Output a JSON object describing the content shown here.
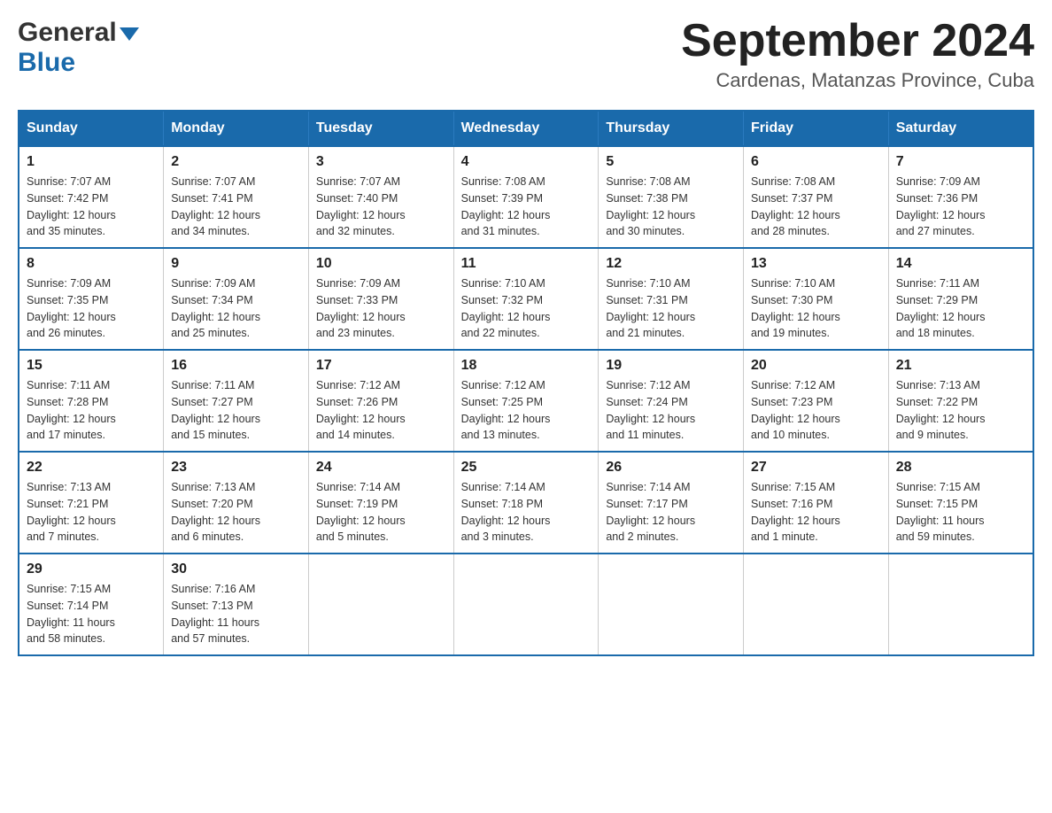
{
  "header": {
    "logo_general": "General",
    "logo_blue": "Blue",
    "month_title": "September 2024",
    "location": "Cardenas, Matanzas Province, Cuba"
  },
  "calendar": {
    "days_of_week": [
      "Sunday",
      "Monday",
      "Tuesday",
      "Wednesday",
      "Thursday",
      "Friday",
      "Saturday"
    ],
    "weeks": [
      [
        {
          "day": "1",
          "sunrise": "7:07 AM",
          "sunset": "7:42 PM",
          "daylight": "12 hours and 35 minutes."
        },
        {
          "day": "2",
          "sunrise": "7:07 AM",
          "sunset": "7:41 PM",
          "daylight": "12 hours and 34 minutes."
        },
        {
          "day": "3",
          "sunrise": "7:07 AM",
          "sunset": "7:40 PM",
          "daylight": "12 hours and 32 minutes."
        },
        {
          "day": "4",
          "sunrise": "7:08 AM",
          "sunset": "7:39 PM",
          "daylight": "12 hours and 31 minutes."
        },
        {
          "day": "5",
          "sunrise": "7:08 AM",
          "sunset": "7:38 PM",
          "daylight": "12 hours and 30 minutes."
        },
        {
          "day": "6",
          "sunrise": "7:08 AM",
          "sunset": "7:37 PM",
          "daylight": "12 hours and 28 minutes."
        },
        {
          "day": "7",
          "sunrise": "7:09 AM",
          "sunset": "7:36 PM",
          "daylight": "12 hours and 27 minutes."
        }
      ],
      [
        {
          "day": "8",
          "sunrise": "7:09 AM",
          "sunset": "7:35 PM",
          "daylight": "12 hours and 26 minutes."
        },
        {
          "day": "9",
          "sunrise": "7:09 AM",
          "sunset": "7:34 PM",
          "daylight": "12 hours and 25 minutes."
        },
        {
          "day": "10",
          "sunrise": "7:09 AM",
          "sunset": "7:33 PM",
          "daylight": "12 hours and 23 minutes."
        },
        {
          "day": "11",
          "sunrise": "7:10 AM",
          "sunset": "7:32 PM",
          "daylight": "12 hours and 22 minutes."
        },
        {
          "day": "12",
          "sunrise": "7:10 AM",
          "sunset": "7:31 PM",
          "daylight": "12 hours and 21 minutes."
        },
        {
          "day": "13",
          "sunrise": "7:10 AM",
          "sunset": "7:30 PM",
          "daylight": "12 hours and 19 minutes."
        },
        {
          "day": "14",
          "sunrise": "7:11 AM",
          "sunset": "7:29 PM",
          "daylight": "12 hours and 18 minutes."
        }
      ],
      [
        {
          "day": "15",
          "sunrise": "7:11 AM",
          "sunset": "7:28 PM",
          "daylight": "12 hours and 17 minutes."
        },
        {
          "day": "16",
          "sunrise": "7:11 AM",
          "sunset": "7:27 PM",
          "daylight": "12 hours and 15 minutes."
        },
        {
          "day": "17",
          "sunrise": "7:12 AM",
          "sunset": "7:26 PM",
          "daylight": "12 hours and 14 minutes."
        },
        {
          "day": "18",
          "sunrise": "7:12 AM",
          "sunset": "7:25 PM",
          "daylight": "12 hours and 13 minutes."
        },
        {
          "day": "19",
          "sunrise": "7:12 AM",
          "sunset": "7:24 PM",
          "daylight": "12 hours and 11 minutes."
        },
        {
          "day": "20",
          "sunrise": "7:12 AM",
          "sunset": "7:23 PM",
          "daylight": "12 hours and 10 minutes."
        },
        {
          "day": "21",
          "sunrise": "7:13 AM",
          "sunset": "7:22 PM",
          "daylight": "12 hours and 9 minutes."
        }
      ],
      [
        {
          "day": "22",
          "sunrise": "7:13 AM",
          "sunset": "7:21 PM",
          "daylight": "12 hours and 7 minutes."
        },
        {
          "day": "23",
          "sunrise": "7:13 AM",
          "sunset": "7:20 PM",
          "daylight": "12 hours and 6 minutes."
        },
        {
          "day": "24",
          "sunrise": "7:14 AM",
          "sunset": "7:19 PM",
          "daylight": "12 hours and 5 minutes."
        },
        {
          "day": "25",
          "sunrise": "7:14 AM",
          "sunset": "7:18 PM",
          "daylight": "12 hours and 3 minutes."
        },
        {
          "day": "26",
          "sunrise": "7:14 AM",
          "sunset": "7:17 PM",
          "daylight": "12 hours and 2 minutes."
        },
        {
          "day": "27",
          "sunrise": "7:15 AM",
          "sunset": "7:16 PM",
          "daylight": "12 hours and 1 minute."
        },
        {
          "day": "28",
          "sunrise": "7:15 AM",
          "sunset": "7:15 PM",
          "daylight": "11 hours and 59 minutes."
        }
      ],
      [
        {
          "day": "29",
          "sunrise": "7:15 AM",
          "sunset": "7:14 PM",
          "daylight": "11 hours and 58 minutes."
        },
        {
          "day": "30",
          "sunrise": "7:16 AM",
          "sunset": "7:13 PM",
          "daylight": "11 hours and 57 minutes."
        },
        null,
        null,
        null,
        null,
        null
      ]
    ],
    "labels": {
      "sunrise": "Sunrise:",
      "sunset": "Sunset:",
      "daylight": "Daylight:"
    }
  }
}
